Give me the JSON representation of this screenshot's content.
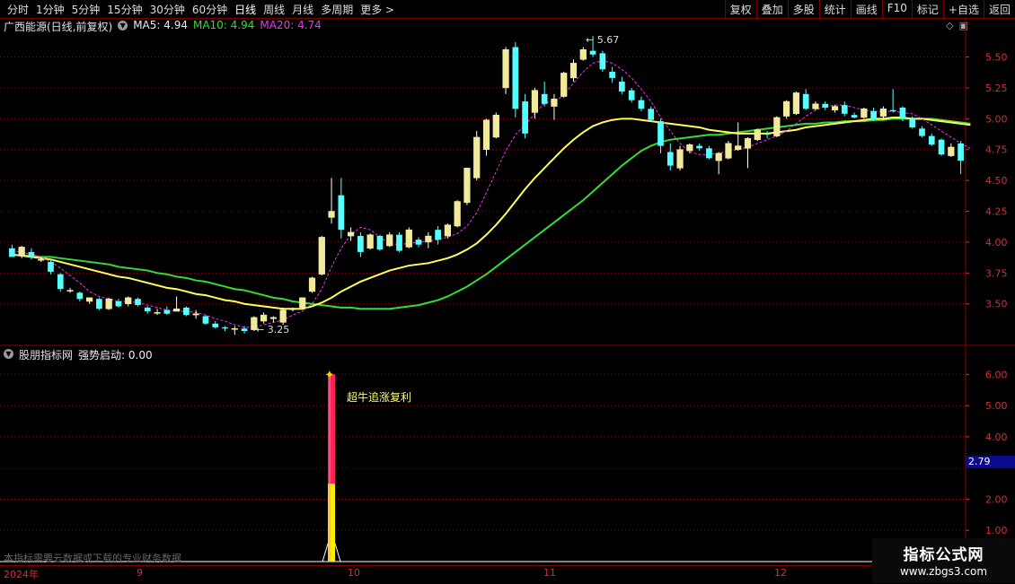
{
  "toolbar": {
    "periods": [
      "分时",
      "1分钟",
      "5分钟",
      "15分钟",
      "30分钟",
      "60分钟",
      "日线",
      "周线",
      "月线",
      "多周期",
      "更多 >"
    ],
    "active_period": "日线",
    "actions": [
      "复权",
      "叠加",
      "多股",
      "统计",
      "画线",
      "F10",
      "标记",
      "+自选",
      "返回"
    ]
  },
  "price_panel": {
    "title": "广西能源(日线,前复权)",
    "ma5": "MA5: 4.94",
    "ma10": "MA10: 4.94",
    "ma20": "MA20: 4.74",
    "high_label": "5.67",
    "low_label": "3.25",
    "axis_ticks": [
      "5.50",
      "5.25",
      "5.00",
      "4.75",
      "4.50",
      "4.25",
      "4.00",
      "3.75",
      "3.50"
    ]
  },
  "indicator_panel": {
    "title": "股朋指标网",
    "indicator": "强势启动: 0.00",
    "signal_text": "超牛追涨复利",
    "axis_ticks": [
      "6.00",
      "5.00",
      "4.00",
      "2.00",
      "1.00"
    ],
    "current_value": "2.79",
    "notice": "本指标需要云数据或下载的专业财务数据"
  },
  "date_axis": {
    "labels": [
      "2024年",
      "9",
      "10",
      "11",
      "12"
    ]
  },
  "watermark": {
    "line1": "指标公式网",
    "line2": "www.zbgs3.com"
  },
  "colors": {
    "up": "#ffffff",
    "down": "#54ffff",
    "up_fill": "#e8e8e8",
    "ma5": "#ee33ee",
    "ma10": "#ffff55",
    "ma20": "#33dd33",
    "grid": "#8a0000",
    "signal_red": "#ff2255",
    "signal_yellow": "#ffee00"
  },
  "chart_data": {
    "type": "candlestick",
    "price_range": [
      3.2,
      5.7
    ],
    "candles": [
      {
        "o": 3.95,
        "h": 3.98,
        "l": 3.88,
        "c": 3.88
      },
      {
        "o": 3.89,
        "h": 3.97,
        "l": 3.87,
        "c": 3.96
      },
      {
        "o": 3.92,
        "h": 3.95,
        "l": 3.86,
        "c": 3.88
      },
      {
        "o": 3.86,
        "h": 3.88,
        "l": 3.84,
        "c": 3.86
      },
      {
        "o": 3.84,
        "h": 3.86,
        "l": 3.74,
        "c": 3.76
      },
      {
        "o": 3.74,
        "h": 3.75,
        "l": 3.6,
        "c": 3.62
      },
      {
        "o": 3.61,
        "h": 3.63,
        "l": 3.59,
        "c": 3.61
      },
      {
        "o": 3.59,
        "h": 3.6,
        "l": 3.52,
        "c": 3.54
      },
      {
        "o": 3.52,
        "h": 3.55,
        "l": 3.5,
        "c": 3.55
      },
      {
        "o": 3.54,
        "h": 3.55,
        "l": 3.45,
        "c": 3.46
      },
      {
        "o": 3.46,
        "h": 3.55,
        "l": 3.45,
        "c": 3.54
      },
      {
        "o": 3.52,
        "h": 3.54,
        "l": 3.47,
        "c": 3.48
      },
      {
        "o": 3.5,
        "h": 3.56,
        "l": 3.48,
        "c": 3.55
      },
      {
        "o": 3.54,
        "h": 3.55,
        "l": 3.48,
        "c": 3.49
      },
      {
        "o": 3.47,
        "h": 3.48,
        "l": 3.42,
        "c": 3.44
      },
      {
        "o": 3.43,
        "h": 3.46,
        "l": 3.41,
        "c": 3.43
      },
      {
        "o": 3.45,
        "h": 3.48,
        "l": 3.41,
        "c": 3.42
      },
      {
        "o": 3.44,
        "h": 3.56,
        "l": 3.44,
        "c": 3.46
      },
      {
        "o": 3.47,
        "h": 3.48,
        "l": 3.4,
        "c": 3.41
      },
      {
        "o": 3.41,
        "h": 3.45,
        "l": 3.38,
        "c": 3.42
      },
      {
        "o": 3.4,
        "h": 3.41,
        "l": 3.33,
        "c": 3.34
      },
      {
        "o": 3.34,
        "h": 3.36,
        "l": 3.3,
        "c": 3.31
      },
      {
        "o": 3.31,
        "h": 3.32,
        "l": 3.28,
        "c": 3.3
      },
      {
        "o": 3.3,
        "h": 3.32,
        "l": 3.25,
        "c": 3.3
      },
      {
        "o": 3.3,
        "h": 3.32,
        "l": 3.26,
        "c": 3.28
      },
      {
        "o": 3.29,
        "h": 3.4,
        "l": 3.28,
        "c": 3.39
      },
      {
        "o": 3.36,
        "h": 3.43,
        "l": 3.34,
        "c": 3.41
      },
      {
        "o": 3.38,
        "h": 3.4,
        "l": 3.35,
        "c": 3.39
      },
      {
        "o": 3.35,
        "h": 3.47,
        "l": 3.33,
        "c": 3.45
      },
      {
        "o": 3.46,
        "h": 3.47,
        "l": 3.44,
        "c": 3.46
      },
      {
        "o": 3.47,
        "h": 3.55,
        "l": 3.46,
        "c": 3.55
      },
      {
        "o": 3.6,
        "h": 3.72,
        "l": 3.59,
        "c": 3.71
      },
      {
        "o": 3.74,
        "h": 4.05,
        "l": 3.73,
        "c": 4.04
      },
      {
        "o": 4.2,
        "h": 4.52,
        "l": 4.15,
        "c": 4.25
      },
      {
        "o": 4.38,
        "h": 4.52,
        "l": 4.03,
        "c": 4.1
      },
      {
        "o": 4.05,
        "h": 4.12,
        "l": 4.01,
        "c": 4.08
      },
      {
        "o": 4.05,
        "h": 4.08,
        "l": 3.88,
        "c": 3.92
      },
      {
        "o": 3.95,
        "h": 4.07,
        "l": 3.94,
        "c": 4.06
      },
      {
        "o": 4.05,
        "h": 4.06,
        "l": 3.93,
        "c": 3.94
      },
      {
        "o": 3.97,
        "h": 4.08,
        "l": 3.96,
        "c": 4.06
      },
      {
        "o": 4.06,
        "h": 4.08,
        "l": 3.92,
        "c": 3.93
      },
      {
        "o": 3.96,
        "h": 4.12,
        "l": 3.95,
        "c": 4.1
      },
      {
        "o": 4.02,
        "h": 4.04,
        "l": 3.96,
        "c": 3.98
      },
      {
        "o": 4.0,
        "h": 4.08,
        "l": 3.95,
        "c": 4.05
      },
      {
        "o": 4.1,
        "h": 4.13,
        "l": 3.98,
        "c": 4.02
      },
      {
        "o": 4.05,
        "h": 4.15,
        "l": 4.03,
        "c": 4.14
      },
      {
        "o": 4.13,
        "h": 4.34,
        "l": 4.12,
        "c": 4.33
      },
      {
        "o": 4.32,
        "h": 4.6,
        "l": 4.3,
        "c": 4.6
      },
      {
        "o": 4.52,
        "h": 4.9,
        "l": 4.5,
        "c": 4.85
      },
      {
        "o": 4.75,
        "h": 5.0,
        "l": 4.7,
        "c": 4.99
      },
      {
        "o": 4.85,
        "h": 5.05,
        "l": 4.84,
        "c": 5.03
      },
      {
        "o": 5.25,
        "h": 5.58,
        "l": 5.2,
        "c": 5.56
      },
      {
        "o": 5.58,
        "h": 5.62,
        "l": 5.01,
        "c": 5.08
      },
      {
        "o": 5.14,
        "h": 5.2,
        "l": 4.84,
        "c": 4.88
      },
      {
        "o": 5.05,
        "h": 5.25,
        "l": 5.0,
        "c": 5.23
      },
      {
        "o": 5.2,
        "h": 5.3,
        "l": 5.1,
        "c": 5.12
      },
      {
        "o": 5.1,
        "h": 5.2,
        "l": 4.99,
        "c": 5.16
      },
      {
        "o": 5.18,
        "h": 5.38,
        "l": 5.17,
        "c": 5.37
      },
      {
        "o": 5.33,
        "h": 5.48,
        "l": 5.3,
        "c": 5.45
      },
      {
        "o": 5.48,
        "h": 5.58,
        "l": 5.47,
        "c": 5.56
      },
      {
        "o": 5.55,
        "h": 5.67,
        "l": 5.5,
        "c": 5.52
      },
      {
        "o": 5.53,
        "h": 5.55,
        "l": 5.38,
        "c": 5.4
      },
      {
        "o": 5.38,
        "h": 5.42,
        "l": 5.29,
        "c": 5.33
      },
      {
        "o": 5.3,
        "h": 5.34,
        "l": 5.2,
        "c": 5.22
      },
      {
        "o": 5.23,
        "h": 5.25,
        "l": 5.13,
        "c": 5.15
      },
      {
        "o": 5.15,
        "h": 5.18,
        "l": 5.06,
        "c": 5.08
      },
      {
        "o": 5.08,
        "h": 5.1,
        "l": 4.98,
        "c": 4.99
      },
      {
        "o": 4.98,
        "h": 5.0,
        "l": 4.72,
        "c": 4.78
      },
      {
        "o": 4.73,
        "h": 4.8,
        "l": 4.58,
        "c": 4.62
      },
      {
        "o": 4.6,
        "h": 4.78,
        "l": 4.58,
        "c": 4.75
      },
      {
        "o": 4.74,
        "h": 4.8,
        "l": 4.72,
        "c": 4.79
      },
      {
        "o": 4.78,
        "h": 4.8,
        "l": 4.74,
        "c": 4.76
      },
      {
        "o": 4.76,
        "h": 4.78,
        "l": 4.67,
        "c": 4.68
      },
      {
        "o": 4.66,
        "h": 4.73,
        "l": 4.55,
        "c": 4.72
      },
      {
        "o": 4.68,
        "h": 4.82,
        "l": 4.67,
        "c": 4.8
      },
      {
        "o": 4.75,
        "h": 4.97,
        "l": 4.74,
        "c": 4.78
      },
      {
        "o": 4.76,
        "h": 4.85,
        "l": 4.6,
        "c": 4.84
      },
      {
        "o": 4.83,
        "h": 4.92,
        "l": 4.82,
        "c": 4.91
      },
      {
        "o": 4.88,
        "h": 4.9,
        "l": 4.84,
        "c": 4.87
      },
      {
        "o": 4.86,
        "h": 5.02,
        "l": 4.85,
        "c": 5.01
      },
      {
        "o": 5.02,
        "h": 5.15,
        "l": 5.0,
        "c": 5.14
      },
      {
        "o": 5.04,
        "h": 5.22,
        "l": 5.03,
        "c": 5.21
      },
      {
        "o": 5.2,
        "h": 5.24,
        "l": 5.07,
        "c": 5.08
      },
      {
        "o": 5.08,
        "h": 5.14,
        "l": 5.07,
        "c": 5.12
      },
      {
        "o": 5.12,
        "h": 5.14,
        "l": 5.07,
        "c": 5.09
      },
      {
        "o": 5.07,
        "h": 5.11,
        "l": 5.05,
        "c": 5.1
      },
      {
        "o": 5.11,
        "h": 5.14,
        "l": 5.02,
        "c": 5.04
      },
      {
        "o": 5.03,
        "h": 5.05,
        "l": 5.0,
        "c": 5.01
      },
      {
        "o": 5.01,
        "h": 5.09,
        "l": 5.0,
        "c": 5.08
      },
      {
        "o": 5.06,
        "h": 5.09,
        "l": 4.98,
        "c": 4.99
      },
      {
        "o": 5.02,
        "h": 5.1,
        "l": 5.0,
        "c": 5.08
      },
      {
        "o": 5.07,
        "h": 5.24,
        "l": 5.05,
        "c": 5.06
      },
      {
        "o": 5.09,
        "h": 5.1,
        "l": 4.98,
        "c": 5.0
      },
      {
        "o": 5.0,
        "h": 5.02,
        "l": 4.92,
        "c": 4.93
      },
      {
        "o": 4.92,
        "h": 4.94,
        "l": 4.85,
        "c": 4.86
      },
      {
        "o": 4.86,
        "h": 4.88,
        "l": 4.78,
        "c": 4.79
      },
      {
        "o": 4.83,
        "h": 4.84,
        "l": 4.7,
        "c": 4.71
      },
      {
        "o": 4.7,
        "h": 4.8,
        "l": 4.69,
        "c": 4.77
      },
      {
        "o": 4.8,
        "h": 4.82,
        "l": 4.55,
        "c": 4.66
      }
    ],
    "ma10": [
      3.9,
      3.89,
      3.88,
      3.87,
      3.86,
      3.84,
      3.82,
      3.8,
      3.78,
      3.76,
      3.74,
      3.72,
      3.71,
      3.69,
      3.67,
      3.65,
      3.63,
      3.62,
      3.6,
      3.58,
      3.57,
      3.55,
      3.53,
      3.52,
      3.5,
      3.49,
      3.48,
      3.47,
      3.46,
      3.46,
      3.46,
      3.48,
      3.51,
      3.55,
      3.6,
      3.64,
      3.68,
      3.71,
      3.74,
      3.77,
      3.79,
      3.81,
      3.82,
      3.83,
      3.85,
      3.87,
      3.9,
      3.94,
      3.99,
      4.06,
      4.14,
      4.23,
      4.33,
      4.43,
      4.52,
      4.6,
      4.68,
      4.76,
      4.83,
      4.89,
      4.94,
      4.97,
      4.99,
      5.0,
      5.0,
      4.99,
      4.98,
      4.97,
      4.96,
      4.95,
      4.94,
      4.93,
      4.91,
      4.9,
      4.89,
      4.88,
      4.88,
      4.88,
      4.88,
      4.89,
      4.9,
      4.91,
      4.93,
      4.94,
      4.95,
      4.96,
      4.97,
      4.98,
      4.99,
      5.0,
      5.0,
      5.01,
      5.01,
      5.0,
      5.0,
      4.99,
      4.98,
      4.97,
      4.96,
      4.95
    ],
    "ma20": [
      3.9,
      3.89,
      3.89,
      3.88,
      3.88,
      3.87,
      3.86,
      3.85,
      3.84,
      3.83,
      3.82,
      3.8,
      3.79,
      3.78,
      3.77,
      3.75,
      3.74,
      3.72,
      3.71,
      3.69,
      3.68,
      3.66,
      3.64,
      3.62,
      3.61,
      3.59,
      3.57,
      3.55,
      3.54,
      3.52,
      3.51,
      3.5,
      3.49,
      3.48,
      3.47,
      3.47,
      3.46,
      3.46,
      3.46,
      3.46,
      3.47,
      3.48,
      3.49,
      3.51,
      3.53,
      3.56,
      3.6,
      3.64,
      3.69,
      3.74,
      3.8,
      3.86,
      3.92,
      3.98,
      4.04,
      4.1,
      4.16,
      4.22,
      4.28,
      4.34,
      4.41,
      4.48,
      4.55,
      4.62,
      4.68,
      4.74,
      4.78,
      4.81,
      4.83,
      4.84,
      4.85,
      4.86,
      4.87,
      4.87,
      4.88,
      4.89,
      4.9,
      4.91,
      4.92,
      4.93,
      4.94,
      4.95,
      4.96,
      4.96,
      4.97,
      4.97,
      4.98,
      4.98,
      4.98,
      4.99,
      4.99,
      5.0,
      5.0,
      5.0,
      5.0,
      5.0,
      4.99,
      4.98,
      4.97,
      4.96
    ],
    "ma5": [
      3.93,
      3.92,
      3.9,
      3.88,
      3.84,
      3.79,
      3.73,
      3.67,
      3.6,
      3.56,
      3.54,
      3.52,
      3.52,
      3.51,
      3.49,
      3.47,
      3.45,
      3.44,
      3.44,
      3.43,
      3.41,
      3.38,
      3.36,
      3.33,
      3.31,
      3.31,
      3.33,
      3.35,
      3.37,
      3.41,
      3.44,
      3.5,
      3.62,
      3.8,
      3.95,
      4.06,
      4.12,
      4.1,
      4.04,
      3.99,
      3.98,
      3.99,
      4.0,
      4.01,
      4.02,
      4.04,
      4.07,
      4.13,
      4.24,
      4.4,
      4.57,
      4.74,
      4.87,
      4.95,
      5.04,
      5.13,
      5.14,
      5.19,
      5.29,
      5.38,
      5.45,
      5.47,
      5.45,
      5.4,
      5.33,
      5.24,
      5.14,
      5.01,
      4.9,
      4.8,
      4.73,
      4.71,
      4.71,
      4.72,
      4.74,
      4.75,
      4.77,
      4.8,
      4.83,
      4.86,
      4.9,
      4.96,
      5.02,
      5.07,
      5.1,
      5.11,
      5.11,
      5.09,
      5.07,
      5.06,
      5.06,
      5.06,
      5.05,
      5.04,
      5.0,
      4.95,
      4.9,
      4.85,
      4.8,
      4.76
    ],
    "indicator": {
      "range": [
        0,
        6.5
      ],
      "signal_index": 33,
      "signal_value": 6.0,
      "yellow_value": 2.5
    }
  }
}
